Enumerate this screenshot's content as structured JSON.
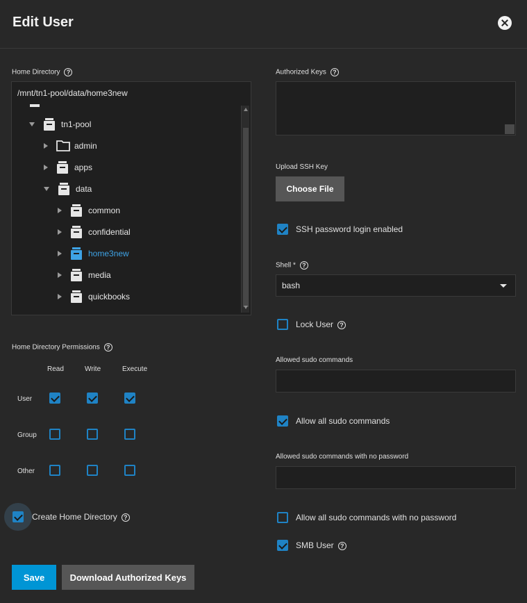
{
  "dialog": {
    "title": "Edit User"
  },
  "home_directory": {
    "label": "Home Directory",
    "path_value": "/mnt/tn1-pool/data/home3new",
    "tree": [
      {
        "name": "tn1-pool",
        "expanded": true,
        "type": "dataset"
      },
      {
        "name": "admin",
        "expanded": false,
        "type": "folder"
      },
      {
        "name": "apps",
        "expanded": false,
        "type": "dataset"
      },
      {
        "name": "data",
        "expanded": true,
        "type": "dataset"
      },
      {
        "name": "common",
        "expanded": false,
        "type": "dataset"
      },
      {
        "name": "confidential",
        "expanded": false,
        "type": "dataset"
      },
      {
        "name": "home3new",
        "expanded": false,
        "type": "dataset",
        "selected": true
      },
      {
        "name": "media",
        "expanded": false,
        "type": "dataset"
      },
      {
        "name": "quickbooks",
        "expanded": false,
        "type": "dataset"
      }
    ]
  },
  "permissions": {
    "label": "Home Directory Permissions",
    "columns": [
      "Read",
      "Write",
      "Execute"
    ],
    "rows": [
      {
        "name": "User",
        "read": true,
        "write": true,
        "execute": true
      },
      {
        "name": "Group",
        "read": false,
        "write": false,
        "execute": false
      },
      {
        "name": "Other",
        "read": false,
        "write": false,
        "execute": false
      }
    ]
  },
  "create_home_directory": {
    "label": "Create Home Directory",
    "checked": true
  },
  "buttons": {
    "save": "Save",
    "download_keys": "Download Authorized Keys",
    "choose_file": "Choose File"
  },
  "authorized_keys": {
    "label": "Authorized Keys",
    "value": ""
  },
  "upload_ssh_key": {
    "label": "Upload SSH Key"
  },
  "ssh_password_login": {
    "label": "SSH password login enabled",
    "checked": true
  },
  "shell": {
    "label": "Shell *",
    "value": "bash"
  },
  "lock_user": {
    "label": "Lock User",
    "checked": false
  },
  "sudo_commands": {
    "label": "Allowed sudo commands",
    "value": ""
  },
  "allow_all_sudo": {
    "label": "Allow all sudo commands",
    "checked": true
  },
  "sudo_nopasswd": {
    "label": "Allowed sudo commands with no password",
    "value": ""
  },
  "allow_all_sudo_nopasswd": {
    "label": "Allow all sudo commands with no password",
    "checked": false
  },
  "smb_user": {
    "label": "SMB User",
    "checked": true
  },
  "colors": {
    "accent": "#0095d5",
    "checkbox": "#1f83c5",
    "selected_text": "#3ea3e6",
    "background": "#282828"
  }
}
